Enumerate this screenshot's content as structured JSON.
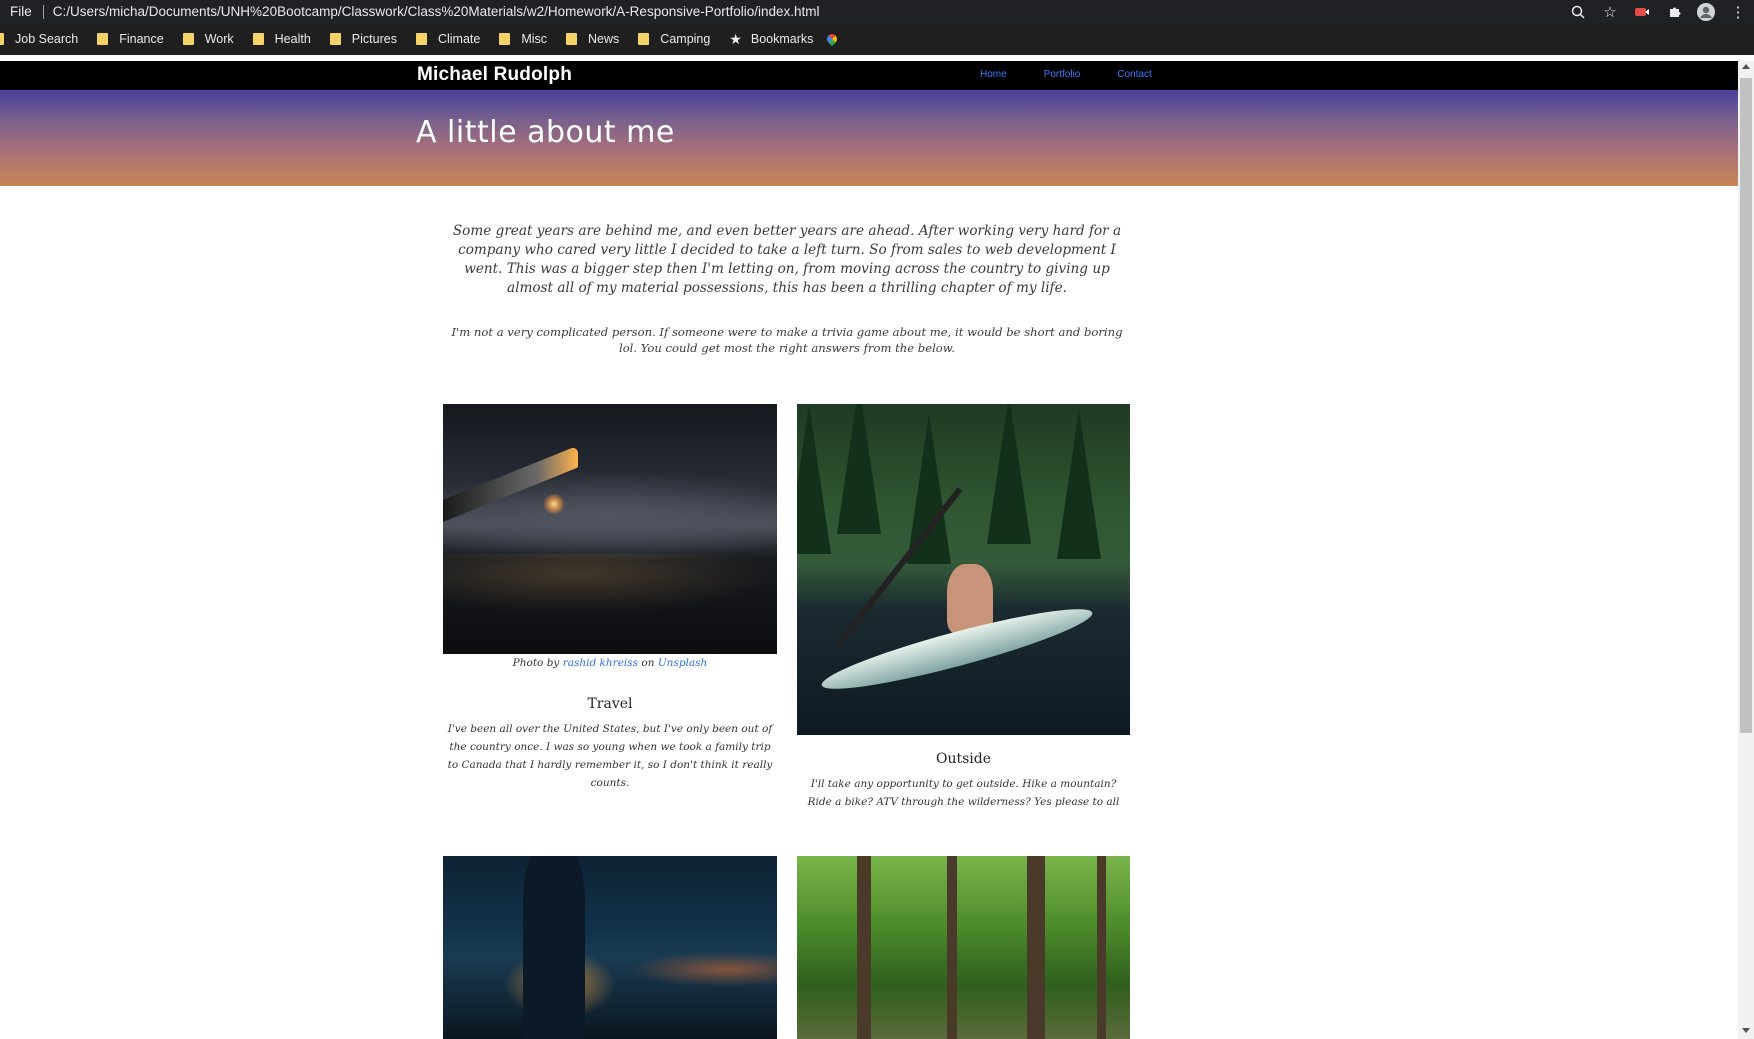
{
  "browser": {
    "file_label": "File",
    "url": "C:/Users/micha/Documents/UNH%20Bootcamp/Classwork/Class%20Materials/w2/Homework/A-Responsive-Portfolio/index.html",
    "bookmarks": [
      "Job Search",
      "Finance",
      "Work",
      "Health",
      "Pictures",
      "Climate",
      "Misc",
      "News",
      "Camping"
    ],
    "bookmarks_star_label": "Bookmarks"
  },
  "site": {
    "brand": "Michael Rudolph",
    "nav": [
      "Home",
      "Portfolio",
      "Contact"
    ],
    "hero_title": "A little about me",
    "intro_p1": "Some great years are behind me, and even better years are ahead. After working very hard for a company who cared very little I decided to take a left turn. So from sales to web development I went. This was a bigger step then I'm letting on, from moving across the country to giving up almost all of my material possessions, this has been a thrilling chapter of my life.",
    "intro_p2": "I'm not a very complicated person. If someone were to make a trivia game about me, it would be short and boring lol. You could get most the right answers from the below.",
    "caption": {
      "prefix": "Photo by",
      "author": "rashid khreiss",
      "middle": "on",
      "source": "Unsplash"
    },
    "cards": [
      {
        "title": "Travel",
        "text": "I've been all over the United States, but I've only been out of the country once. I was so young when we took a family trip to Canada that I hardly remember it, so I don't think it really counts."
      },
      {
        "title": "Outside",
        "text": "I'll take any opportunity to get outside. Hike a mountain? Ride a bike? ATV through the wilderness? Yes please to all"
      }
    ]
  }
}
